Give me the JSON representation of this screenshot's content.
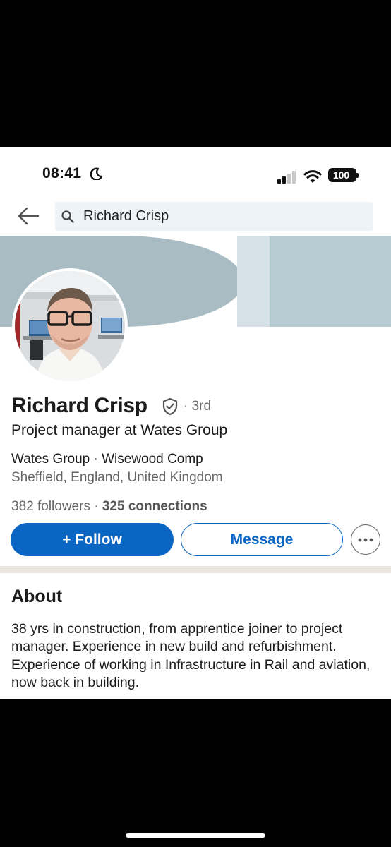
{
  "status_bar": {
    "time": "08:41",
    "battery": "100",
    "moon_icon": "moon-icon",
    "signal_icon": "cellular-signal-icon",
    "wifi_icon": "wifi-icon"
  },
  "search": {
    "query": "Richard Crisp",
    "back_icon": "arrow-left-icon",
    "search_icon": "search-icon"
  },
  "profile": {
    "name": "Richard Crisp",
    "degree": "· 3rd",
    "headline": "Project manager at Wates Group",
    "companies": "Wates Group · Wisewood Comp",
    "location": "Sheffield, England, United Kingdom",
    "followers": "382 followers",
    "separator": " · ",
    "connections": "325 connections",
    "verified_icon": "verified-shield-icon"
  },
  "actions": {
    "follow_label": "+ Follow",
    "message_label": "Message",
    "more_icon": "more-horizontal-icon"
  },
  "about": {
    "title": "About",
    "text": "38 yrs in construction, from apprentice joiner to project manager. Experience in new build and refurbishment. Experience of working in Infrastructure in Rail and aviation, now back in building."
  },
  "colors": {
    "accent": "#0a66c2",
    "banner_gray": "#a9bcc4",
    "banner_light": "#d5e1e6",
    "banner_right": "#b6ccd3",
    "divider": "#e9e5df",
    "search_bg": "#eef3f8"
  }
}
